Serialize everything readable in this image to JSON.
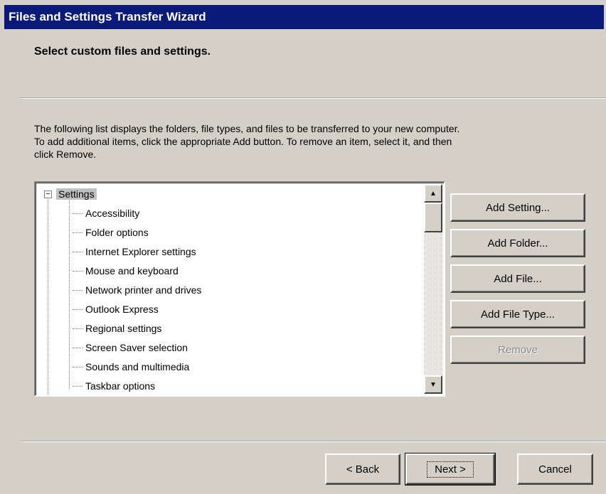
{
  "window": {
    "title": "Files and Settings Transfer Wizard"
  },
  "header": {
    "heading": "Select custom files and settings."
  },
  "description": {
    "line1": "The following list displays the folders, file types, and files to be transferred to your new computer.",
    "line2": "To add additional items, click the appropriate Add button. To remove an item, select it, and then",
    "line3": "click Remove."
  },
  "tree": {
    "root": {
      "label": "Settings",
      "expander": "−",
      "selected": true
    },
    "items": [
      {
        "label": "Accessibility"
      },
      {
        "label": "Folder options"
      },
      {
        "label": "Internet Explorer settings"
      },
      {
        "label": "Mouse and keyboard"
      },
      {
        "label": "Network printer and drives"
      },
      {
        "label": "Outlook Express"
      },
      {
        "label": "Regional settings"
      },
      {
        "label": "Screen Saver selection"
      },
      {
        "label": "Sounds and multimedia"
      },
      {
        "label": "Taskbar options"
      }
    ]
  },
  "scrollbar": {
    "up_icon": "▲",
    "down_icon": "▼"
  },
  "side_buttons": {
    "add_setting": "Add Setting...",
    "add_folder": "Add Folder...",
    "add_file": "Add File...",
    "add_file_type": "Add File Type...",
    "remove": "Remove",
    "remove_enabled": false
  },
  "footer": {
    "back": "< Back",
    "next": "Next >",
    "cancel": "Cancel"
  },
  "colors": {
    "titlebar": "#0a1a7a",
    "face": "#d4d0c8",
    "selection": "#c0c0c0"
  }
}
